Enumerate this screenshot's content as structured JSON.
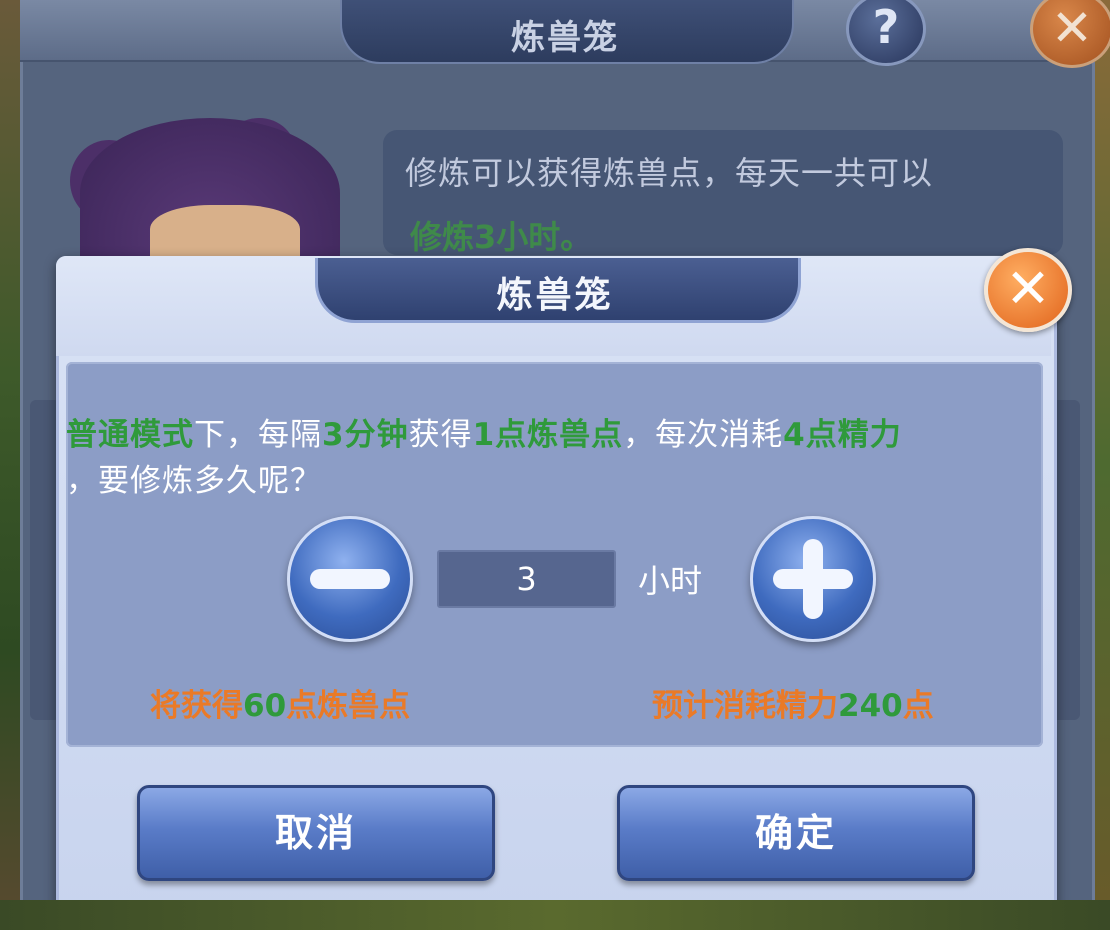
{
  "background_dialog": {
    "title": "炼兽笼",
    "help_label": "?",
    "close_label": "✕",
    "speech_line1": "修炼可以获得炼兽点，每天一共可以",
    "speech_line2": "修炼3小时。"
  },
  "dialog": {
    "title": "炼兽笼",
    "close_label": "✕",
    "message": {
      "p1": "普通模式",
      "p2": "下，每隔",
      "p3": "3分钟",
      "p4": "获得",
      "p5": "1点炼兽点",
      "p6": "，每次消耗",
      "p7": "4点精力",
      "p8": "，要修炼多久呢？"
    },
    "duration": {
      "value": "3",
      "unit": "小时"
    },
    "gain": {
      "prefix": "将获得",
      "amount": "60",
      "suffix": "点炼兽点"
    },
    "cost": {
      "prefix": "预计消耗精力",
      "amount": "240",
      "suffix": "点"
    },
    "buttons": {
      "cancel": "取消",
      "confirm": "确定"
    }
  },
  "colors": {
    "highlight_green": "#2f9a3b",
    "highlight_orange": "#ea7a27",
    "button_blue": "#5a7cc8",
    "close_orange": "#e0621a"
  }
}
